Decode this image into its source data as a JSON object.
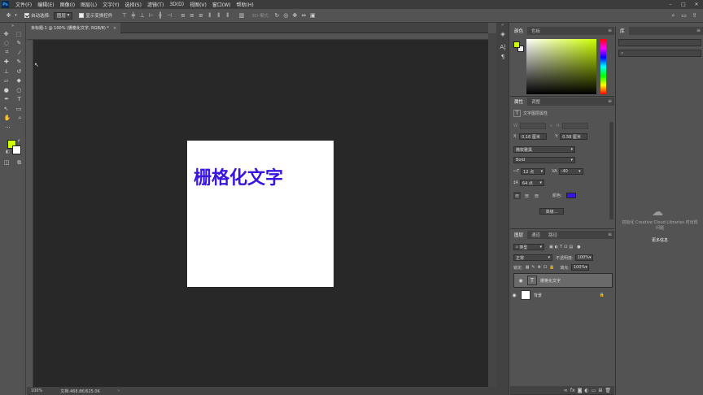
{
  "app": {
    "logo": "Ps"
  },
  "menu": [
    "文件(F)",
    "编辑(E)",
    "图像(I)",
    "图层(L)",
    "文字(Y)",
    "选择(S)",
    "滤镜(T)",
    "3D(D)",
    "视图(V)",
    "窗口(W)",
    "帮助(H)"
  ],
  "window_controls": [
    "–",
    "□",
    "✕"
  ],
  "options": {
    "auto_select_label": "自动选择:",
    "auto_select_value": "图层",
    "show_transform_label": "显示变换控件",
    "mode3d_label": "3D 模式:"
  },
  "document": {
    "tab_title": "未标题-1 @ 100% (栅格化文字, RGB/8) *",
    "close": "×",
    "canvas_text": "栅格化文字",
    "text_color": "#3a14e0"
  },
  "tools": {
    "foreground_color": "#ccff00",
    "background_color": "#ffffff"
  },
  "color_panel": {
    "tabs": [
      "颜色",
      "色板"
    ],
    "fg": "#ccff00",
    "bg": "#eeeeee"
  },
  "properties_panel": {
    "tabs": [
      "属性",
      "调整"
    ],
    "layer_type": "文字图层属性",
    "w": "W:",
    "h": "H:",
    "x_label": "X:",
    "x_value": "0.16 厘米",
    "y_label": "Y:",
    "y_value": "0.58 厘米",
    "font_family": "微软雅黑",
    "font_style": "Bold",
    "font_size": "12 点",
    "tracking": "-40",
    "leading": "64 点",
    "color_label": "颜色:",
    "advanced": "高级..."
  },
  "layers_panel": {
    "tabs": [
      "图层",
      "通道",
      "路径"
    ],
    "filter": "类型",
    "blend_mode": "正常",
    "opacity_label": "不透明度:",
    "opacity": "100%",
    "lock_label": "锁定:",
    "fill_label": "填充:",
    "fill": "100%",
    "layers": [
      {
        "name": "栅格化文字",
        "type": "text"
      },
      {
        "name": "背景",
        "type": "background"
      }
    ]
  },
  "libraries_panel": {
    "tab": "库",
    "message": "初始化 Creative Cloud Libraries 时出现问题",
    "link": "更多信息"
  },
  "status": {
    "zoom": "100%",
    "doc_info": "文档:468.8K/625.0K"
  }
}
